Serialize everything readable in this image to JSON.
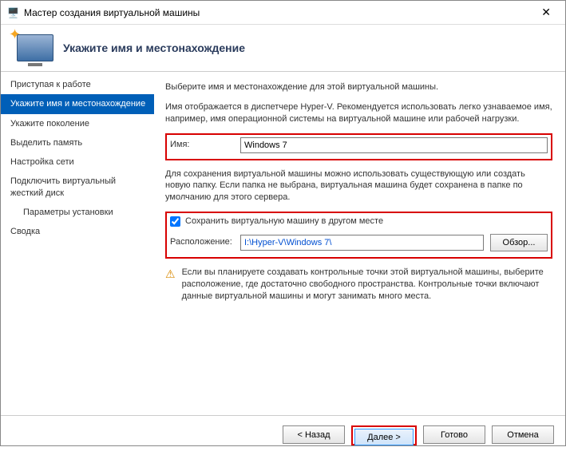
{
  "window": {
    "title": "Мастер создания виртуальной машины"
  },
  "header": {
    "heading": "Укажите имя и местонахождение"
  },
  "sidebar": {
    "items": [
      {
        "label": "Приступая к работе",
        "selected": false
      },
      {
        "label": "Укажите имя и местонахождение",
        "selected": true
      },
      {
        "label": "Укажите поколение",
        "selected": false
      },
      {
        "label": "Выделить память",
        "selected": false
      },
      {
        "label": "Настройка сети",
        "selected": false
      },
      {
        "label": "Подключить виртуальный жесткий диск",
        "selected": false
      },
      {
        "label": "Параметры установки",
        "selected": false,
        "sub": true
      },
      {
        "label": "Сводка",
        "selected": false
      }
    ]
  },
  "main": {
    "intro1": "Выберите имя и местонахождение для этой виртуальной машины.",
    "intro2": "Имя отображается в диспетчере Hyper-V. Рекомендуется использовать легко узнаваемое имя, например, имя операционной системы на виртуальной машине или рабочей нагрузки.",
    "name_label": "Имя:",
    "name_value": "Windows 7",
    "store_text": "Для сохранения виртуальной машины можно использовать существующую или создать новую папку. Если папка не выбрана, виртуальная машина будет сохранена в папке по умолчанию для этого сервера.",
    "store_checkbox": "Сохранить виртуальную машину в другом месте",
    "store_checked": true,
    "location_label": "Расположение:",
    "location_value": "I:\\Hyper-V\\Windows 7\\",
    "browse": "Обзор...",
    "warning": "Если вы планируете создавать контрольные точки этой виртуальной машины, выберите расположение, где достаточно свободного пространства. Контрольные точки включают данные виртуальной машины и могут занимать много места."
  },
  "footer": {
    "back": "< Назад",
    "next": "Далее >",
    "finish": "Готово",
    "cancel": "Отмена"
  }
}
